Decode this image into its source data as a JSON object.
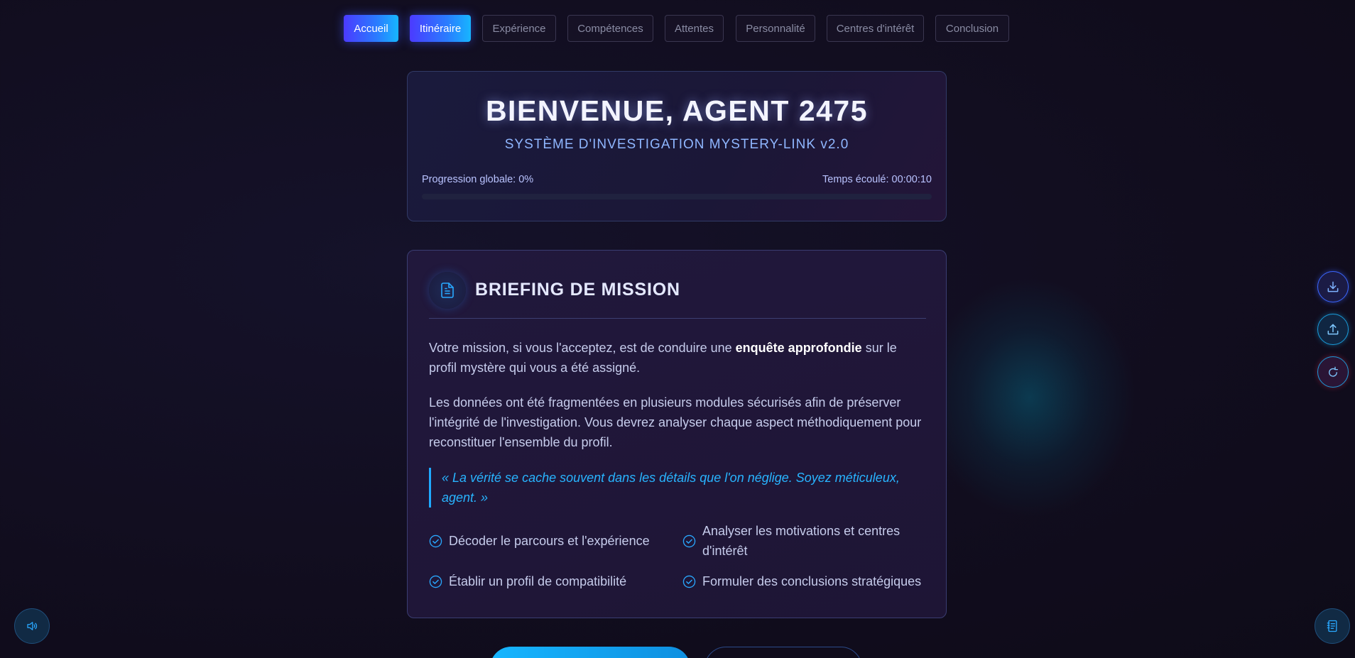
{
  "nav": {
    "items": [
      {
        "label": "Accueil",
        "active": true
      },
      {
        "label": "Itinéraire",
        "active": true
      },
      {
        "label": "Expérience",
        "active": false
      },
      {
        "label": "Compétences",
        "active": false
      },
      {
        "label": "Attentes",
        "active": false
      },
      {
        "label": "Personnalité",
        "active": false
      },
      {
        "label": "Centres d'intérêt",
        "active": false
      },
      {
        "label": "Conclusion",
        "active": false
      }
    ]
  },
  "welcome": {
    "title": "BIENVENUE, AGENT 2475",
    "subtitle": "SYSTÈME D'INVESTIGATION MYSTERY-LINK v2.0",
    "progress_label": "Progression globale: 0%",
    "progress_value": 0,
    "time_label": "Temps écoulé: 00:00:10"
  },
  "briefing": {
    "icon": "document-icon",
    "title": "BRIEFING DE MISSION",
    "para1_before": "Votre mission, si vous l'acceptez, est de conduire une ",
    "para1_bold": "enquête approfondie",
    "para1_after": " sur le profil mystère qui vous a été assigné.",
    "para2": "Les données ont été fragmentées en plusieurs modules sécurisés afin de préserver l'intégrité de l'investigation. Vous devrez analyser chaque aspect méthodiquement pour reconstituer l'ensemble du profil.",
    "quote": "« La vérité se cache souvent dans les détails que l'on néglige. Soyez méticuleux, agent. »",
    "objectives": [
      "Décoder le parcours et l'expérience",
      "Analyser les motivations et centres d'intérêt",
      "Établir un profil de compatibilité",
      "Formuler des conclusions stratégiques"
    ]
  },
  "side_buttons": {
    "download_icon": "download-icon",
    "upload_icon": "upload-icon",
    "reset_icon": "reset-icon",
    "sound_icon": "sound-icon",
    "notes_icon": "notes-icon"
  },
  "colors": {
    "accent_blue": "#17b6ff",
    "accent_purple": "#4b3bff",
    "background": "#110d1e",
    "quote_color": "#28b4ff"
  }
}
